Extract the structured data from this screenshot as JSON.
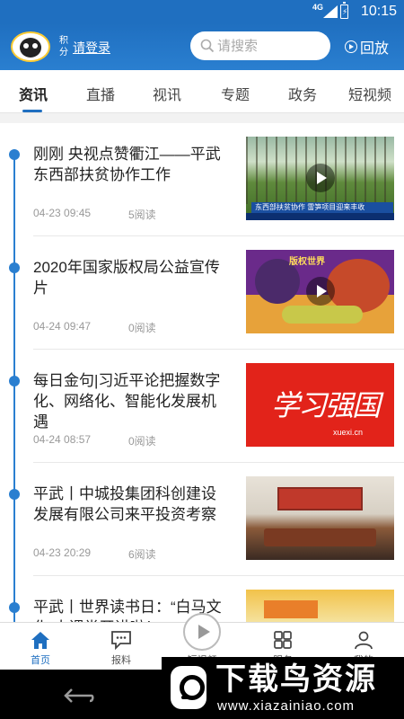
{
  "status_bar": {
    "network": "4G",
    "battery_icon": "battery-charging-icon",
    "time": "10:15"
  },
  "header": {
    "logo_icon": "panda-logo-icon",
    "points_label": "积分",
    "login_link": "请登录",
    "search_placeholder": "请搜索",
    "replay_label": "回放"
  },
  "tabs": [
    {
      "label": "资讯",
      "active": true
    },
    {
      "label": "直播",
      "active": false
    },
    {
      "label": "视讯",
      "active": false
    },
    {
      "label": "专题",
      "active": false
    },
    {
      "label": "政务",
      "active": false
    },
    {
      "label": "短视频",
      "active": false
    }
  ],
  "feed": {
    "items": [
      {
        "title": "刚刚 央视点赞衢江——平武东西部扶贫协作工作",
        "date": "04-23 09:45",
        "reads": "5阅读",
        "has_video": true,
        "thumb_caption": "东西部扶贫协作 雷笋项目迎来丰收"
      },
      {
        "title": "2020年国家版权局公益宣传片",
        "date": "04-24 09:47",
        "reads": "0阅读",
        "has_video": true,
        "thumb_caption": "版权世界"
      },
      {
        "title": "每日金句|习近平论把握数字化、网络化、智能化发展机遇",
        "date": "04-24 08:57",
        "reads": "0阅读",
        "has_video": false,
        "thumb_caption": "学习强国",
        "thumb_sub": "xuexi.cn"
      },
      {
        "title": "平武丨中城投集团科创建设发展有限公司来平投资考察",
        "date": "04-23 20:29",
        "reads": "6阅读",
        "has_video": false
      },
      {
        "title": "平武丨世界读书日：“白马文化”大课堂开讲啦！",
        "date": "",
        "reads": "",
        "has_video": false
      }
    ]
  },
  "bottom_nav": [
    {
      "label": "首页",
      "icon": "home-icon",
      "active": true
    },
    {
      "label": "报料",
      "icon": "chat-report-icon",
      "active": false
    },
    {
      "label": "短视频",
      "icon": "play-circle-icon",
      "active": false
    },
    {
      "label": "服务",
      "icon": "grid-service-icon",
      "active": false
    },
    {
      "label": "我的",
      "icon": "person-icon",
      "active": false
    }
  ],
  "watermark": {
    "title": "下载鸟资源",
    "url": "www.xiazainiao.com"
  },
  "colors": {
    "brand_blue": "#1f6fc0",
    "timeline_blue": "#2a7fd0"
  }
}
